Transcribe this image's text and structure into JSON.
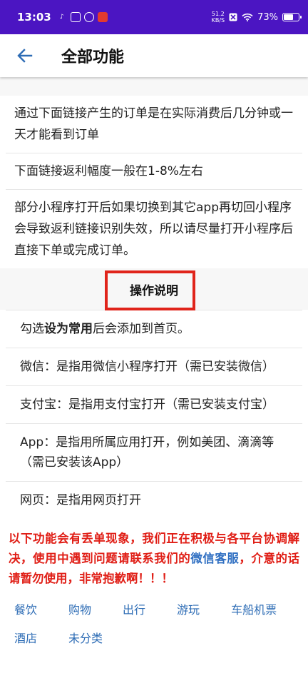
{
  "status_bar": {
    "time": "13:03",
    "speed_value": "51.2",
    "speed_unit": "KB/S",
    "battery_percent": "73%",
    "battery_level": 0.73
  },
  "header": {
    "title": "全部功能"
  },
  "info_items": [
    "通过下面链接产生的订单是在实际消费后几分钟或一天才能看到订单",
    "下面链接返利幅度一般在1-8%左右",
    "部分小程序打开后如果切换到其它app再切回小程序会导致返利链接识别失效，所以请尽量打开小程序后直接下单或完成订单。"
  ],
  "section": {
    "title": "操作说明"
  },
  "ops": {
    "item0_pre": "勾选",
    "item0_bold": "设为常用",
    "item0_post": "后会添加到首页。",
    "item1": "微信：是指用微信小程序打开（需已安装微信）",
    "item2": "支付宝：是指用支付宝打开（需已安装支付宝）",
    "item3": "App：是指用所属应用打开，例如美团、滴滴等（需已安装该App）",
    "item4": "网页：是指用网页打开"
  },
  "warning": {
    "part1": "以下功能会有丢单现象，我们正在积极与各平台协调解决，使用中遇到问题请联系我们的",
    "link": "微信客服",
    "part2": "，介意的话请暂勿使用，非常抱歉啊！！！"
  },
  "categories": [
    "餐饮",
    "购物",
    "出行",
    "游玩",
    "车船机票",
    "酒店",
    "未分类"
  ],
  "colors": {
    "status_bar": "#4b15c2",
    "accent_blue": "#2d6cb5",
    "warning_red": "#e01e16",
    "highlight_red": "#e0241b"
  }
}
